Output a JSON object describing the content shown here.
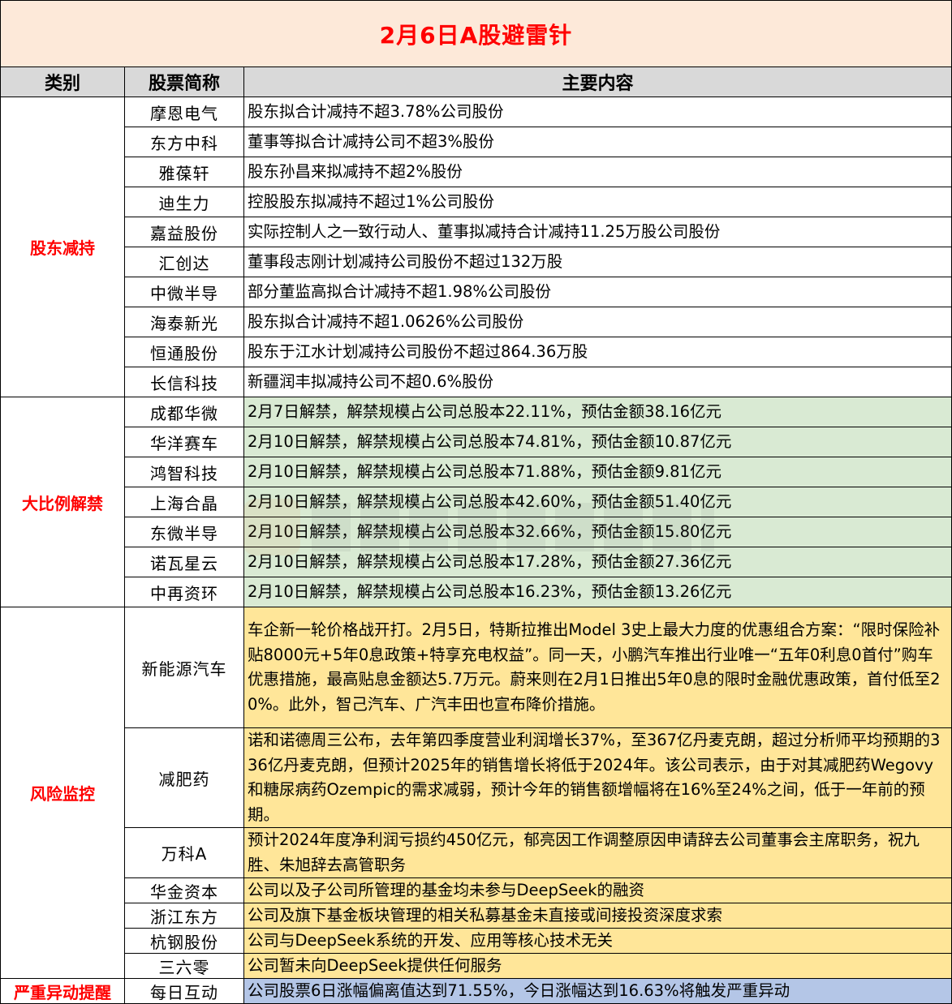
{
  "title": "2月6日A股避雷针",
  "headers": {
    "category": "类别",
    "stock": "股票简称",
    "content": "主要内容"
  },
  "sections": [
    {
      "category": "股东减持",
      "rows": [
        {
          "name": "摩恩电气",
          "content": "股东拟合计减持不超3.78%公司股份"
        },
        {
          "name": "东方中科",
          "content": "董事等拟合计减持公司不超3%股份"
        },
        {
          "name": "雅葆轩",
          "content": "股东孙昌来拟减持不超2%股份"
        },
        {
          "name": "迪生力",
          "content": "控股股东拟减持不超过1%公司股份"
        },
        {
          "name": "嘉益股份",
          "content": "实际控制人之一致行动人、董事拟减持合计减持11.25万股公司股份"
        },
        {
          "name": "汇创达",
          "content": "董事段志刚计划减持公司股份不超过132万股"
        },
        {
          "name": "中微半导",
          "content": "部分董监高拟合计减持不超1.98%公司股份"
        },
        {
          "name": "海泰新光",
          "content": "股东拟合计减持不超1.0626%公司股份"
        },
        {
          "name": "恒通股份",
          "content": "股东于江水计划减持公司股份不超过864.36万股"
        },
        {
          "name": "长信科技",
          "content": "新疆润丰拟减持公司不超0.6%股份"
        }
      ]
    },
    {
      "category": "大比例解禁",
      "rows": [
        {
          "name": "成都华微",
          "content": "2月7日解禁，解禁规模占公司总股本22.11%，预估金额38.16亿元"
        },
        {
          "name": "华洋赛车",
          "content": "2月10日解禁，解禁规模占公司总股本74.81%，预估金额10.87亿元"
        },
        {
          "name": "鸿智科技",
          "content": "2月10日解禁，解禁规模占公司总股本71.88%，预估金额9.81亿元"
        },
        {
          "name": "上海合晶",
          "content": "2月10日解禁，解禁规模占公司总股本42.60%，预估金额51.40亿元"
        },
        {
          "name": "东微半导",
          "content": "2月10日解禁，解禁规模占公司总股本32.66%，预估金额15.80亿元"
        },
        {
          "name": "诺瓦星云",
          "content": "2月10日解禁，解禁规模占公司总股本17.28%，预估金额27.36亿元"
        },
        {
          "name": "中再资环",
          "content": "2月10日解禁，解禁规模占公司总股本16.23%，预估金额13.26亿元"
        }
      ]
    },
    {
      "category": "风险监控",
      "rows": [
        {
          "name": "新能源汽车",
          "content": "车企新一轮价格战开打。2月5日，特斯拉推出Model 3史上最大力度的优惠组合方案：“限时保险补贴8000元+5年0息政策+特享充电权益”。同一天，小鹏汽车推出行业唯一“五年0利息0首付”购车优惠措施，最高贴息金额达5.7万元。蔚来则在2月1日推出5年0息的限时金融优惠政策，首付低至20%。此外，智己汽车、广汽丰田也宣布降价措施。"
        },
        {
          "name": "减肥药",
          "content": "诺和诺德周三公布，去年第四季度营业利润增长37%，至367亿丹麦克朗，超过分析师平均预期的336亿丹麦克朗，但预计2025年的销售增长将低于2024年。该公司表示，由于对其减肥药Wegovy和糖尿病药Ozempic的需求减弱，预计今年的销售额增幅将在16%至24%之间，低于一年前的预期。"
        },
        {
          "name": "万科A",
          "content": "预计2024年度净利润亏损约450亿元，郁亮因工作调整原因申请辞去公司董事会主席职务，祝九胜、朱旭辞去高管职务"
        },
        {
          "name": "华金资本",
          "content": "公司以及子公司所管理的基金均未参与DeepSeek的融资"
        },
        {
          "name": "浙江东方",
          "content": "公司及旗下基金板块管理的相关私募基金未直接或间接投资深度求索"
        },
        {
          "name": "杭钢股份",
          "content": "公司与DeepSeek系统的开发、应用等核心技术无关"
        },
        {
          "name": "三六零",
          "content": "公司暂未向DeepSeek提供任何服务"
        }
      ]
    },
    {
      "category": "严重异动提醒",
      "rows": [
        {
          "name": "每日互动",
          "content": "公司股票6日涨幅偏离值达到71.55%，今日涨幅达到16.63%将触发严重异动"
        }
      ]
    }
  ],
  "colors": {
    "title_bg": "#fde9d9",
    "title_text": "#ff0000",
    "header_bg": "#d9d9d9",
    "category_text": "#ff0000",
    "unlock_bg": "#d9ead3",
    "risk_bg": "#ffe699",
    "alert_bg": "#b4c6e7"
  }
}
